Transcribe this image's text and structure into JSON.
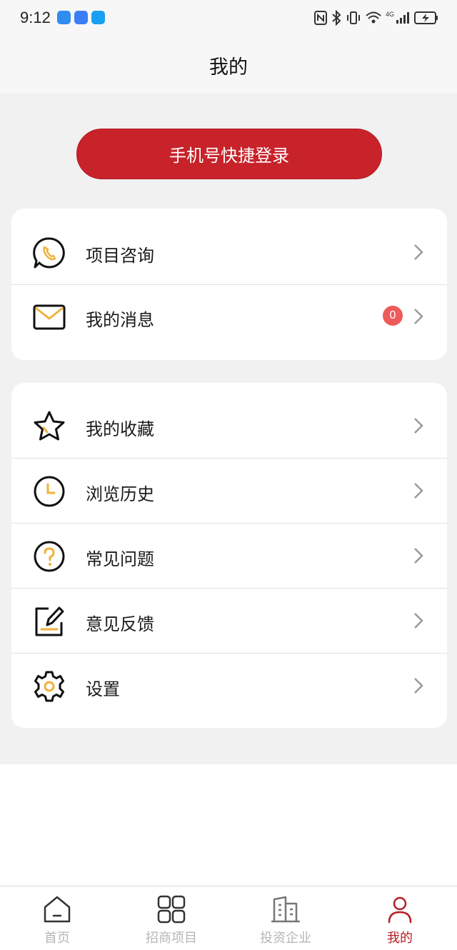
{
  "status_bar": {
    "time": "9:12",
    "network": "4G"
  },
  "header": {
    "title": "我的"
  },
  "login": {
    "label": "手机号快捷登录"
  },
  "menu_group_1": [
    {
      "label": "项目咨询",
      "icon": "phone-chat-icon"
    },
    {
      "label": "我的消息",
      "icon": "mail-icon",
      "badge": "0"
    }
  ],
  "menu_group_2": [
    {
      "label": "我的收藏",
      "icon": "star-icon"
    },
    {
      "label": "浏览历史",
      "icon": "clock-icon"
    },
    {
      "label": "常见问题",
      "icon": "question-icon"
    },
    {
      "label": "意见反馈",
      "icon": "edit-icon"
    },
    {
      "label": "设置",
      "icon": "gear-icon"
    }
  ],
  "tabs": [
    {
      "label": "首页",
      "icon": "home-icon",
      "active": false
    },
    {
      "label": "招商项目",
      "icon": "grid-icon",
      "active": false
    },
    {
      "label": "投资企业",
      "icon": "building-icon",
      "active": false
    },
    {
      "label": "我的",
      "icon": "user-icon",
      "active": true
    }
  ],
  "colors": {
    "accent": "#c8222a",
    "icon_accent": "#f0b23a",
    "badge": "#ef5a5a",
    "tab_inactive": "#b6b6b6"
  }
}
